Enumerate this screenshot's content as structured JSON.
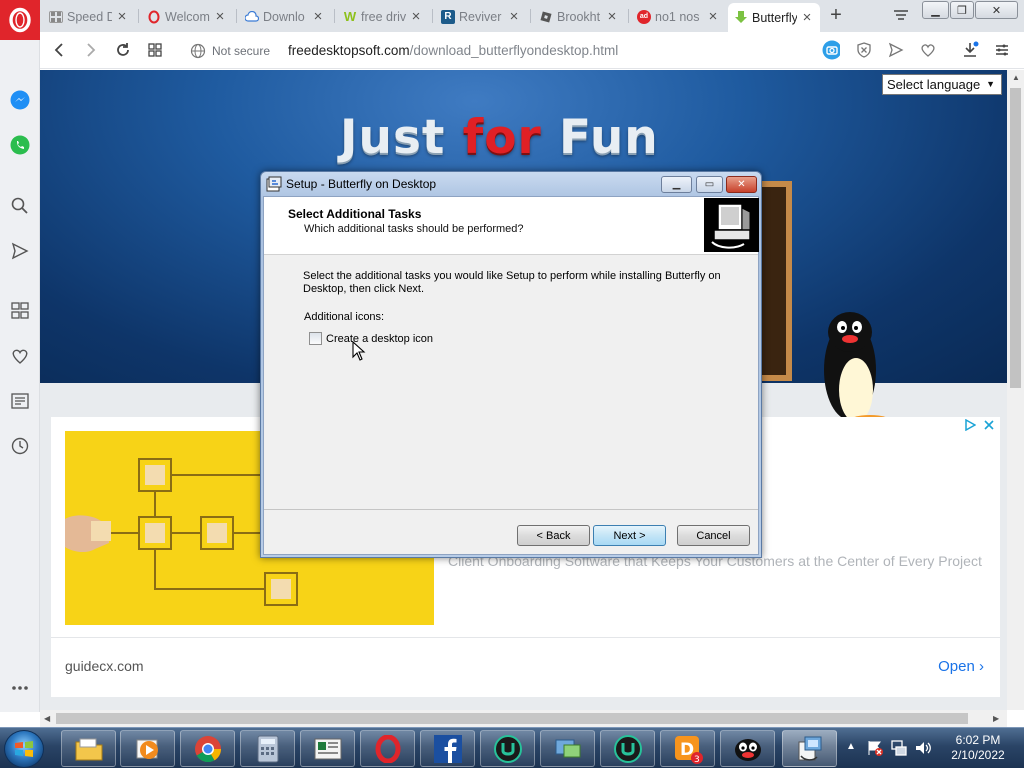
{
  "browser": {
    "tabs": [
      {
        "title": "Speed D",
        "icon": "grid-icon"
      },
      {
        "title": "Welcom",
        "icon": "opera-icon"
      },
      {
        "title": "Downlo",
        "icon": "cloud-icon"
      },
      {
        "title": "free driv",
        "icon": "w-icon"
      },
      {
        "title": "Reviver",
        "icon": "reviver-icon"
      },
      {
        "title": "Brookht",
        "icon": "roblox-icon"
      },
      {
        "title": "no1 nos",
        "icon": "ad-icon"
      },
      {
        "title": "Butterfly",
        "icon": "download-arrow-icon",
        "active": true
      }
    ],
    "address": {
      "security": "Not secure",
      "host": "freedesktopsoft.com",
      "path": "/download_butterflyondesktop.html"
    },
    "accent_color": "#e0252b"
  },
  "page": {
    "hero": {
      "title_part1": "Just ",
      "title_part2": "for",
      "title_part3": " Fun"
    },
    "language_select": "Select language",
    "ad": {
      "tagline": "Client Onboarding Software that Keeps Your Customers at the Center of Every Project",
      "domain": "guidecx.com",
      "open_label": "Open"
    }
  },
  "dialog": {
    "window_title": "Setup - Butterfly on Desktop",
    "header_title": "Select Additional Tasks",
    "header_subtitle": "Which additional tasks should be performed?",
    "description": "Select the additional tasks you would like Setup to perform while installing Butterfly on Desktop, then click Next.",
    "group_label": "Additional icons:",
    "checkbox_label": "Create a desktop icon",
    "checkbox_checked": false,
    "buttons": {
      "back": "< Back",
      "next": "Next >",
      "cancel": "Cancel"
    }
  },
  "taskbar": {
    "badge_count": "3",
    "time": "6:02 PM",
    "date": "2/10/2022"
  }
}
